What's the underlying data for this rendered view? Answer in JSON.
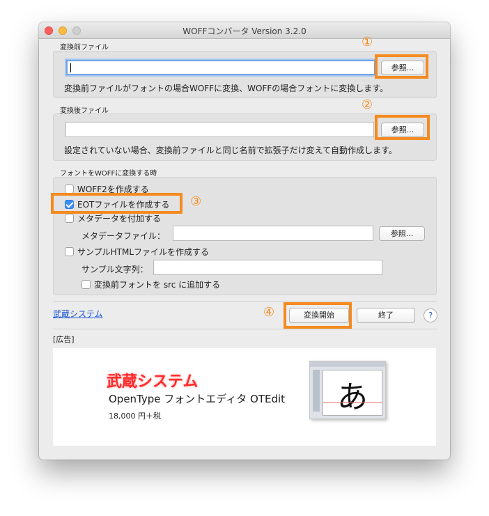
{
  "window": {
    "title": "WOFFコンバータ Version 3.2.0"
  },
  "source": {
    "section_label": "変換前ファイル",
    "input_value": "",
    "browse_label": "参照...",
    "description": "変換前ファイルがフォントの場合WOFFに変換、WOFFの場合フォントに変換します。",
    "annotation": "①"
  },
  "dest": {
    "section_label": "変換後ファイル",
    "input_value": "",
    "browse_label": "参照...",
    "description": "設定されていない場合、変換前ファイルと同じ名前で拡張子だけ変えて自動作成します。",
    "annotation": "②"
  },
  "options": {
    "section_label": "フォントをWOFFに変換する時",
    "woff2_label": "WOFF2を作成する",
    "eot_label": "EOTファイルを作成する",
    "eot_annotation": "③",
    "metadata_label": "メタデータを付加する",
    "metadata_file_label": "メタデータファイル：",
    "metadata_browse_label": "参照...",
    "sample_html_label": "サンプルHTMLファイルを作成する",
    "sample_text_label": "サンプル文字列：",
    "add_src_label": "変換前フォントを src に追加する",
    "woff2_checked": false,
    "eot_checked": true,
    "metadata_checked": false,
    "sample_html_checked": false,
    "add_src_checked": false
  },
  "footer": {
    "link_label": "武蔵システム",
    "start_label": "変換開始",
    "start_annotation": "④",
    "quit_label": "終了",
    "help_label": "?"
  },
  "ad": {
    "section_label": "[広告]",
    "brand": "武蔵システム",
    "product": "OpenType フォントエディタ  OTEdit",
    "price": "18,000 円＋税",
    "glyph": "あ"
  },
  "colors": {
    "highlight": "#f58a1f",
    "brand_red": "#ff2a2a",
    "focus_ring": "#6fa3e8",
    "checkbox_checked": "#3b8ef6"
  },
  "icons": {
    "red": "close-light-icon",
    "yellow": "minimize-light-icon",
    "gray": "zoom-light-icon",
    "check": "checkmark-icon",
    "help": "help-icon"
  }
}
